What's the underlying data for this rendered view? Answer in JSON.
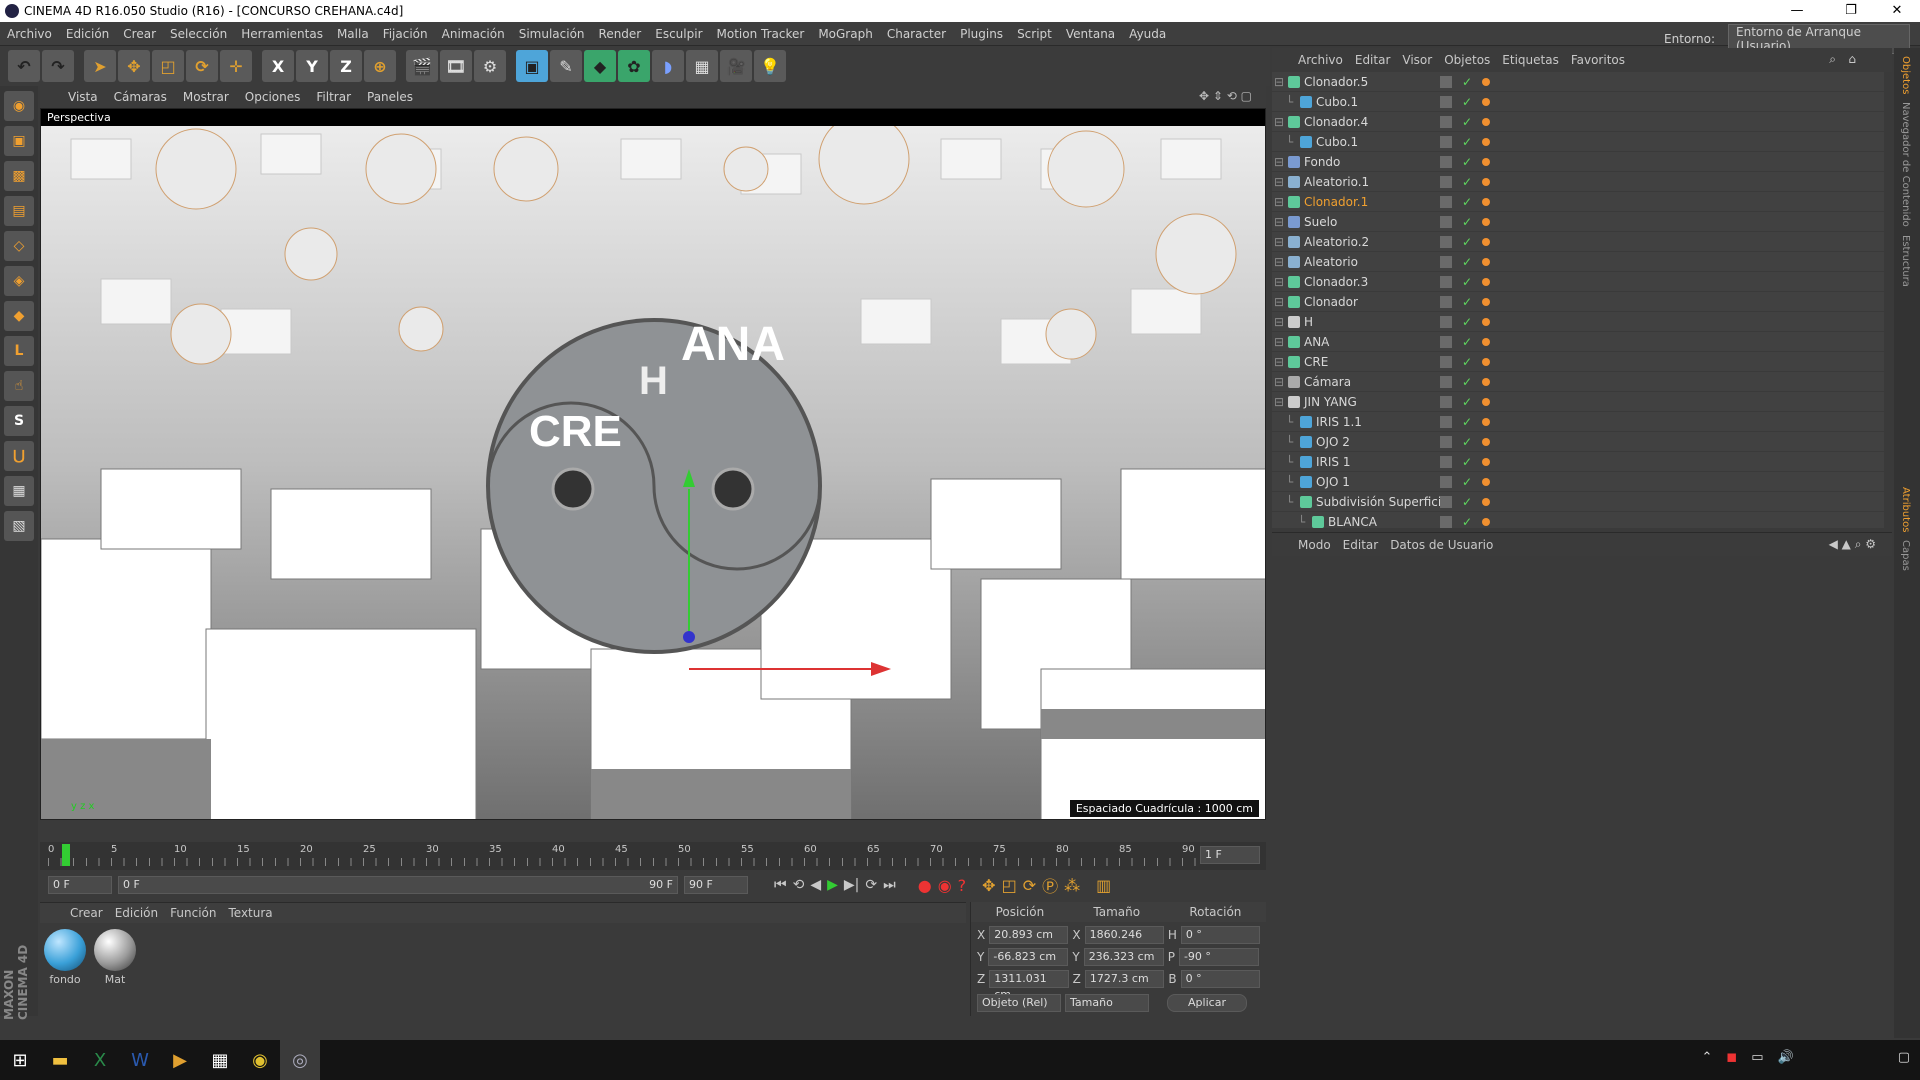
{
  "window": {
    "title": "CINEMA 4D R16.050 Studio (R16) - [CONCURSO CREHANA.c4d]"
  },
  "menubar": {
    "items": [
      "Archivo",
      "Edición",
      "Crear",
      "Selección",
      "Herramientas",
      "Malla",
      "Fijación",
      "Animación",
      "Simulación",
      "Render",
      "Esculpir",
      "Motion Tracker",
      "MoGraph",
      "Character",
      "Plugins",
      "Script",
      "Ventana",
      "Ayuda"
    ],
    "env_label": "Entorno:",
    "env_value": "Entorno de Arranque (Usuario)"
  },
  "toolbar": {
    "x": "X",
    "y": "Y",
    "z": "Z"
  },
  "viewport": {
    "menu": [
      "Vista",
      "Cámaras",
      "Mostrar",
      "Opciones",
      "Filtrar",
      "Paneles"
    ],
    "camera_label": "Perspectiva",
    "grid_spacing": "Espaciado Cuadrícula : 1000 cm",
    "scene_text_1": "ANA",
    "scene_text_2": "CRE",
    "scene_text_3": "H"
  },
  "timeline": {
    "ticks": [
      "0",
      "5",
      "10",
      "15",
      "20",
      "25",
      "30",
      "35",
      "40",
      "45",
      "50",
      "55",
      "60",
      "65",
      "70",
      "75",
      "80",
      "85",
      "90"
    ],
    "current": "1 F",
    "start": "0 F",
    "range_start": "0 F",
    "range_end": "90 F",
    "end": "90 F"
  },
  "materials": {
    "menu": [
      "Crear",
      "Edición",
      "Función",
      "Textura"
    ],
    "items": [
      {
        "name": "fondo",
        "color": "#3aa0d8"
      },
      {
        "name": "Mat",
        "color": "#9a9a9a"
      }
    ]
  },
  "coords": {
    "headers": [
      "Posición",
      "Tamaño",
      "Rotación"
    ],
    "rows": [
      {
        "axis": "X",
        "pos": "20.893 cm",
        "size_axis": "X",
        "size": "1860.246 cm",
        "rot_axis": "H",
        "rot": "0 °"
      },
      {
        "axis": "Y",
        "pos": "-66.823 cm",
        "size_axis": "Y",
        "size": "236.323 cm",
        "rot_axis": "P",
        "rot": "-90 °"
      },
      {
        "axis": "Z",
        "pos": "1311.031 cm",
        "size_axis": "Z",
        "size": "1727.3 cm",
        "rot_axis": "B",
        "rot": "0 °"
      }
    ],
    "mode": "Objeto (Rel)",
    "size_mode": "Tamaño",
    "apply": "Aplicar"
  },
  "objects": {
    "menu": [
      "Archivo",
      "Editar",
      "Visor",
      "Objetos",
      "Etiquetas",
      "Favoritos"
    ],
    "items": [
      {
        "name": "Clonador.5",
        "indent": 0,
        "color": "#5ec99a"
      },
      {
        "name": "Cubo.1",
        "indent": 1,
        "color": "#4ea5d9"
      },
      {
        "name": "Clonador.4",
        "indent": 0,
        "color": "#5ec99a"
      },
      {
        "name": "Cubo.1",
        "indent": 1,
        "color": "#4ea5d9"
      },
      {
        "name": "Fondo",
        "indent": 0,
        "color": "#7a9ad0"
      },
      {
        "name": "Aleatorio.1",
        "indent": 0,
        "color": "#8ab0d0"
      },
      {
        "name": "Clonador.1",
        "indent": 0,
        "color": "#5ec99a",
        "highlight": true
      },
      {
        "name": "Suelo",
        "indent": 0,
        "color": "#7a9ad0"
      },
      {
        "name": "Aleatorio.2",
        "indent": 0,
        "color": "#8ab0d0"
      },
      {
        "name": "Aleatorio",
        "indent": 0,
        "color": "#8ab0d0"
      },
      {
        "name": "Clonador.3",
        "indent": 0,
        "color": "#5ec99a"
      },
      {
        "name": "Clonador",
        "indent": 0,
        "color": "#5ec99a"
      },
      {
        "name": "H",
        "indent": 0,
        "color": "#cccccc"
      },
      {
        "name": "ANA",
        "indent": 0,
        "color": "#5ec99a"
      },
      {
        "name": "CRE",
        "indent": 0,
        "color": "#5ec99a"
      },
      {
        "name": "Cámara",
        "indent": 0,
        "color": "#aaaaaa"
      },
      {
        "name": "JIN YANG",
        "indent": 0,
        "color": "#cccccc"
      },
      {
        "name": "IRIS 1.1",
        "indent": 1,
        "color": "#4ea5d9"
      },
      {
        "name": "OJO 2",
        "indent": 1,
        "color": "#4ea5d9"
      },
      {
        "name": "IRIS 1",
        "indent": 1,
        "color": "#4ea5d9"
      },
      {
        "name": "OJO 1",
        "indent": 1,
        "color": "#4ea5d9"
      },
      {
        "name": "Subdivisión Superficie",
        "indent": 1,
        "color": "#5ec99a"
      },
      {
        "name": "BLANCA",
        "indent": 2,
        "color": "#5ec99a"
      }
    ]
  },
  "attributes": {
    "menu": [
      "Modo",
      "Editar",
      "Datos de Usuario"
    ]
  },
  "right_tabs": [
    "Objetos",
    "Navegador de Contenido",
    "Estructura",
    "Atributos",
    "Capas"
  ],
  "brand": "MAXON CINEMA 4D"
}
